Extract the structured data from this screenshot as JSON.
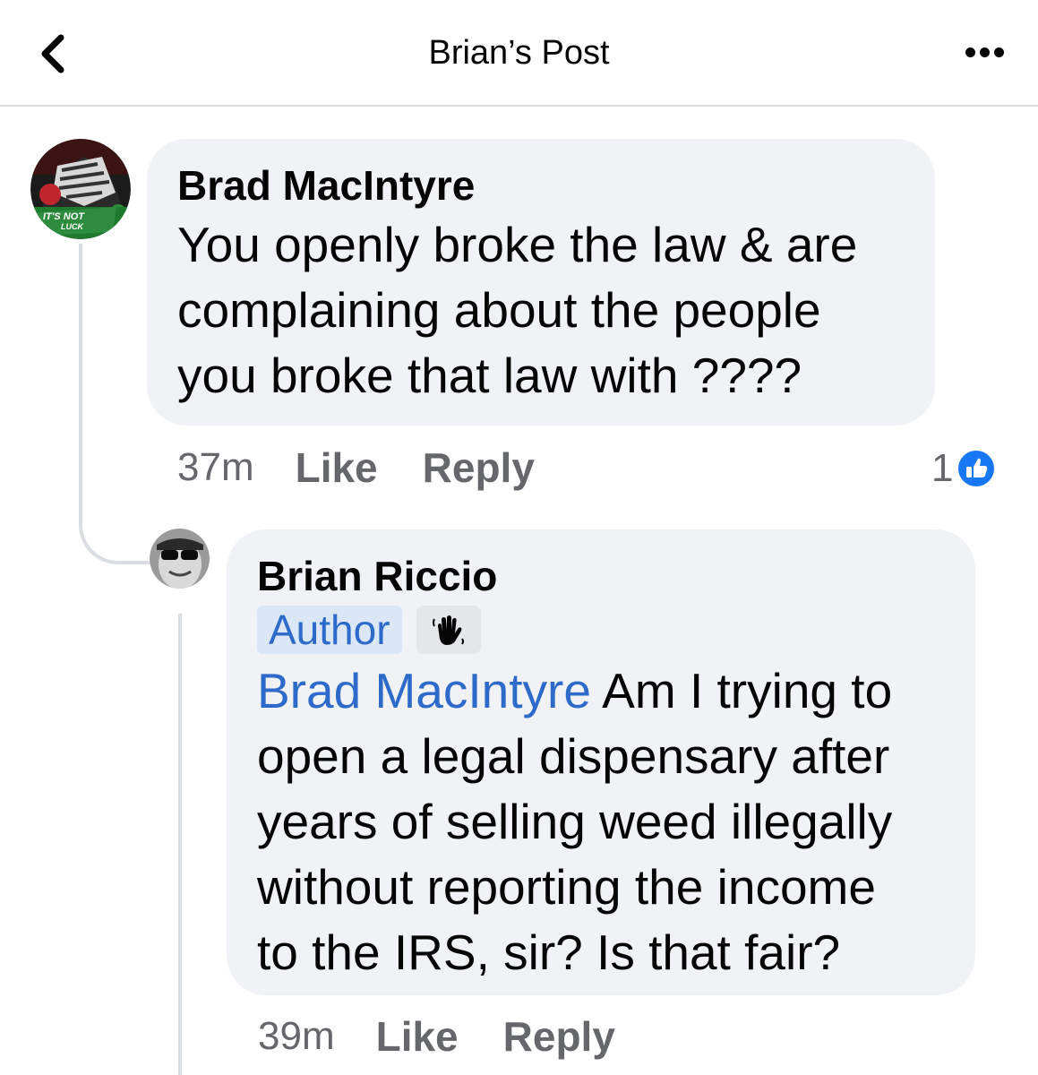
{
  "header": {
    "title": "Brian’s Post",
    "back_icon": "chevron-left-icon",
    "more_icon": "more-horizontal-icon"
  },
  "comments": [
    {
      "author": "Brad MacIntyre",
      "avatar_text": [
        "IT'S NOT",
        "LUCK"
      ],
      "text_lines": [
        "You openly broke the law & are",
        "complaining about the people",
        "you broke that law with ????"
      ],
      "time": "37m",
      "like_label": "Like",
      "reply_label": "Reply",
      "reaction_count": "1",
      "reaction_icon": "like-reaction-icon"
    },
    {
      "author": "Brian Riccio",
      "badge": "Author",
      "badge_icon": "waving-hand-icon",
      "mention": "Brad MacIntyre",
      "text_lines": [
        " Am I trying to",
        "open a legal dispensary after",
        "years of selling weed illegally",
        "without reporting the income",
        "to the IRS, sir? Is that fair?"
      ],
      "time": "39m",
      "like_label": "Like",
      "reply_label": "Reply"
    }
  ],
  "colors": {
    "bubble": "#f0f2f5",
    "link_blue": "#2d6ac9",
    "meta_gray": "#65676b",
    "like_blue": "#1877f2"
  }
}
